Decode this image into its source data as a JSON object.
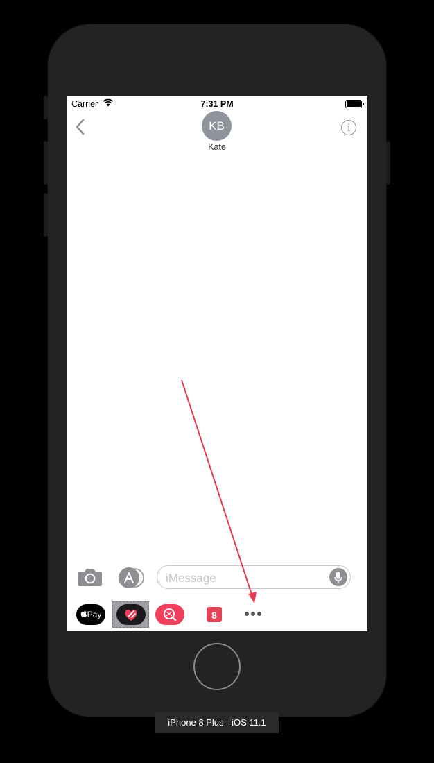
{
  "status_bar": {
    "carrier": "Carrier",
    "time": "7:31 PM"
  },
  "conversation": {
    "avatar_initials": "KB",
    "contact_name": "Kate"
  },
  "composer": {
    "placeholder": "iMessage"
  },
  "app_drawer": {
    "apple_pay_label": "Pay",
    "calendar_label": "8"
  },
  "device_label": "iPhone 8 Plus - iOS 11.1",
  "colors": {
    "accent_red": "#ef3f5b",
    "annotation_arrow": "#e8394f",
    "icon_gray": "#8e8e93"
  },
  "icons": [
    "back-chevron-icon",
    "info-icon",
    "camera-icon",
    "app-store-icon",
    "mic-icon",
    "apple-logo-icon",
    "heart-icon",
    "search-icon",
    "more-icon"
  ]
}
